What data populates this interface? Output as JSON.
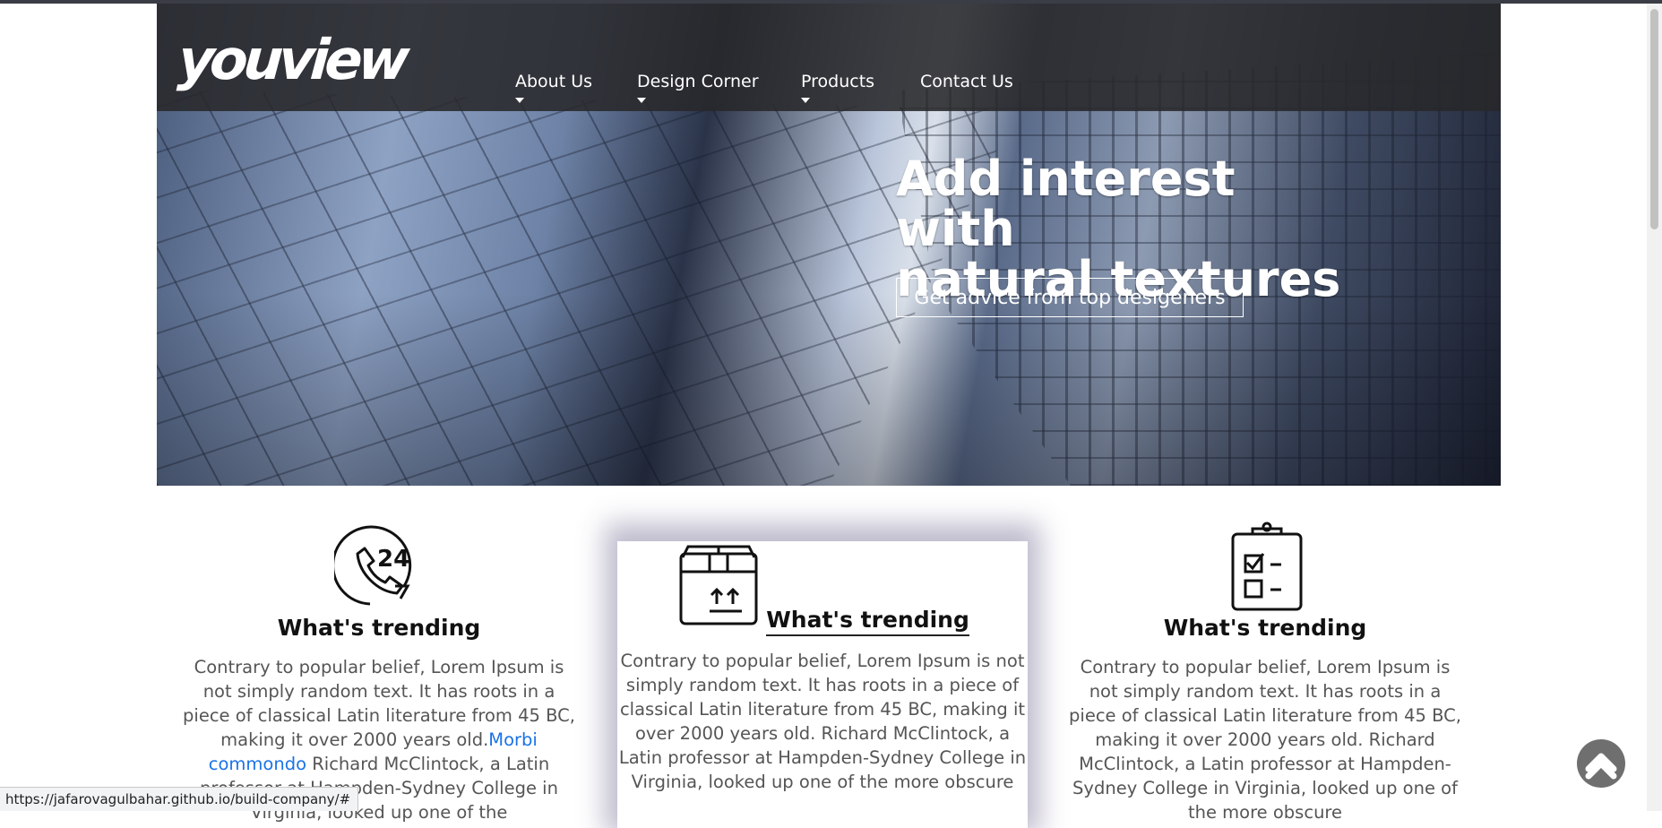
{
  "header": {
    "logo_text": "youview",
    "nav": [
      {
        "label": "About Us",
        "has_dropdown": true
      },
      {
        "label": "Design Corner",
        "has_dropdown": true
      },
      {
        "label": "Products",
        "has_dropdown": true
      },
      {
        "label": "Contact Us",
        "has_dropdown": false
      }
    ]
  },
  "hero": {
    "title_line1": "Add interest with",
    "title_line2": "natural textures",
    "cta_label": "Get advice from top desigeners"
  },
  "features": [
    {
      "icon": "phone-24-icon",
      "title": "What's trending",
      "text_before_link": "Contrary to popular belief, Lorem Ipsum is not simply random text. It has roots in a piece of classical Latin literature from 45 BC, making it over 2000 years old.",
      "link": "Morbi commondo",
      "text_after_link": " Richard McClintock, a Latin professor at Hampden-Sydney College in Virginia, looked up one of the"
    },
    {
      "icon": "box-upload-icon",
      "title": "What's trending",
      "text": "Contrary to popular belief, Lorem Ipsum is not simply random text. It has roots in a piece of classical Latin literature from 45 BC, making it over 2000 years old. Richard McClintock, a Latin professor at Hampden-Sydney College in Virginia, looked up one of the more obscure"
    },
    {
      "icon": "clipboard-checklist-icon",
      "title": "What's trending",
      "text": "Contrary to popular belief, Lorem Ipsum is not simply random text. It has roots in a piece of classical Latin literature from 45 BC, making it over 2000 years old. Richard McClintock, a Latin professor at Hampden-Sydney College in Virginia, looked up one of the more obscure"
    }
  ],
  "status_bar": {
    "url": "https://jafarovagulbahar.github.io/build-company/#"
  },
  "colors": {
    "navbar": "#28282a",
    "link": "#1a73e8",
    "scroll_top": "#6f6f6f"
  }
}
